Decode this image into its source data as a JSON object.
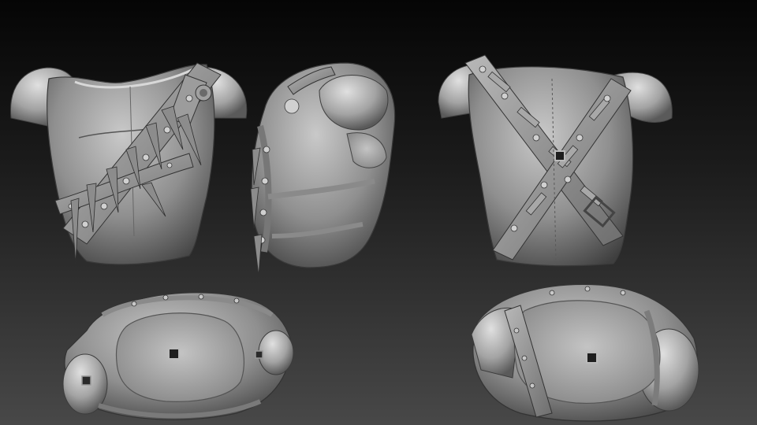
{
  "scene": {
    "description_colors": {
      "background_top": "#050505",
      "background_bottom": "#484848",
      "model_base": "#9a9a9a",
      "model_shadow": "#3c3c3c",
      "model_highlight": "#d4d4d4"
    },
    "views": [
      {
        "id": "front",
        "icon": "torso-front-view"
      },
      {
        "id": "side",
        "icon": "torso-side-view"
      },
      {
        "id": "back",
        "icon": "torso-back-view"
      },
      {
        "id": "bottom-front",
        "icon": "torso-bottom-view"
      },
      {
        "id": "bottom-back",
        "icon": "torso-top-view"
      }
    ]
  }
}
